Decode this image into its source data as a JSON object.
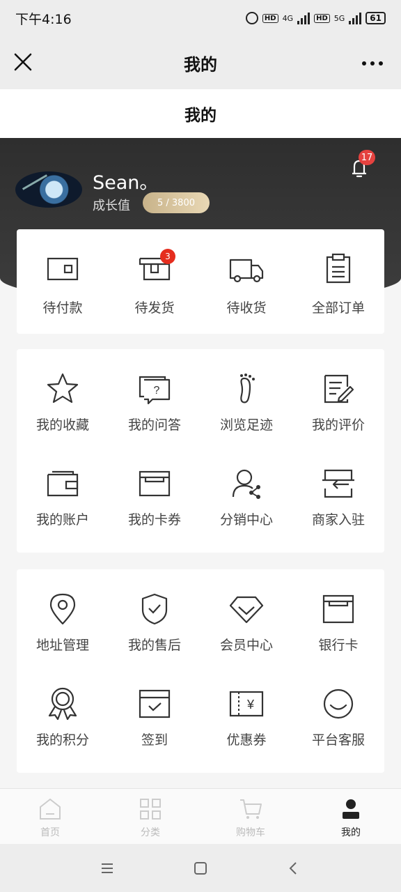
{
  "status": {
    "time": "下午4:16",
    "net1": "4G",
    "net2": "5G",
    "battery": "61",
    "hd": "HD"
  },
  "wechat_bar": {
    "title": "我的"
  },
  "page": {
    "title": "我的"
  },
  "profile": {
    "username": "Sean。",
    "growth_label": "成长值",
    "growth_value": "5 / 3800",
    "notification_count": "17"
  },
  "orders": [
    {
      "label": "待付款",
      "icon": "wallet-icon"
    },
    {
      "label": "待发货",
      "icon": "box-icon",
      "badge": "3"
    },
    {
      "label": "待收货",
      "icon": "truck-icon"
    },
    {
      "label": "全部订单",
      "icon": "clipboard-icon"
    }
  ],
  "services": [
    {
      "label": "我的收藏",
      "icon": "star-icon"
    },
    {
      "label": "我的问答",
      "icon": "question-icon"
    },
    {
      "label": "浏览足迹",
      "icon": "footprint-icon"
    },
    {
      "label": "我的评价",
      "icon": "edit-icon"
    },
    {
      "label": "我的账户",
      "icon": "wallet-icon"
    },
    {
      "label": "我的卡券",
      "icon": "card-icon"
    },
    {
      "label": "分销中心",
      "icon": "share-user-icon"
    },
    {
      "label": "商家入驻",
      "icon": "store-icon"
    }
  ],
  "tools": [
    {
      "label": "地址管理",
      "icon": "location-icon"
    },
    {
      "label": "我的售后",
      "icon": "shield-icon"
    },
    {
      "label": "会员中心",
      "icon": "diamond-icon"
    },
    {
      "label": "银行卡",
      "icon": "bankcard-icon"
    },
    {
      "label": "我的积分",
      "icon": "medal-icon"
    },
    {
      "label": "签到",
      "icon": "checkin-icon"
    },
    {
      "label": "优惠券",
      "icon": "coupon-icon"
    },
    {
      "label": "平台客服",
      "icon": "smile-icon"
    }
  ],
  "tabbar": [
    {
      "label": "首页",
      "icon": "home-icon"
    },
    {
      "label": "分类",
      "icon": "grid-icon"
    },
    {
      "label": "购物车",
      "icon": "cart-icon"
    },
    {
      "label": "我的",
      "icon": "user-icon",
      "active": true
    }
  ],
  "colors": {
    "accent": "#e52d1e",
    "dark": "#333333",
    "gold": "#d8c29a"
  }
}
